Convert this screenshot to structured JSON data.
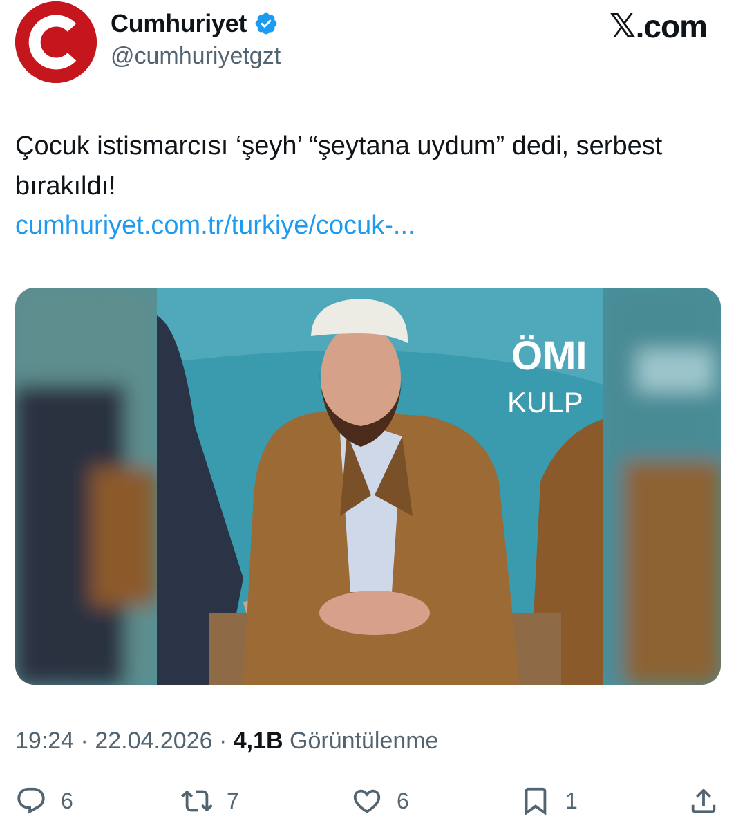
{
  "account": {
    "display_name": "Cumhuriyet",
    "handle": "@cumhuriyetgzt",
    "verified_icon": "verified-badge-icon",
    "avatar_icon": "cumhuriyet-logo"
  },
  "brand": {
    "label": ".com",
    "glyph": "𝕏"
  },
  "tweet": {
    "text": "Çocuk istismarcısı ‘şeyh’ “şeytana uydum” dedi, serbest bırakıldı!",
    "link": "cumhuriyet.com.tr/turkiye/cocuk-...",
    "media_overlay_line1": "ÖMI",
    "media_overlay_line2": "KULP"
  },
  "meta": {
    "time": "19:24",
    "separator": "·",
    "date": "22.04.2026",
    "views_count": "4,1B",
    "views_label": "Görüntülenme"
  },
  "actions": {
    "reply_count": "6",
    "retweet_count": "7",
    "like_count": "6",
    "bookmark_count": "1"
  },
  "colors": {
    "link": "#1d9bf0",
    "muted": "#536471",
    "text": "#0f1419",
    "logo_red": "#c4161c",
    "verified": "#1d9bf0"
  }
}
